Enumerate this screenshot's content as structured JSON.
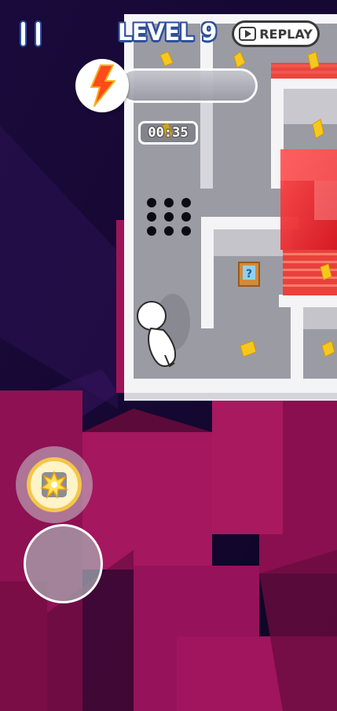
{
  "hud": {
    "level_title": "LEVEL 9",
    "replay_label": "REPLAY",
    "timer": "00:35",
    "energy_level": 0.0
  },
  "icons": {
    "pause": "pause-icon",
    "replay": "play-icon",
    "energy": "lightning-bolt-icon",
    "ability": "explosion-icon",
    "mystery_box": "question-mark-box-icon"
  },
  "colors": {
    "background_sky": "#12082c",
    "floor_block": "#a0155e",
    "maze_floor": "#9a9aa2",
    "maze_wall": "#f2f2f4",
    "danger_zone": "#e8222a",
    "coin": "#f6c81e",
    "bolt": "#ff3a1a",
    "text_outline": "#2e4f9c"
  }
}
